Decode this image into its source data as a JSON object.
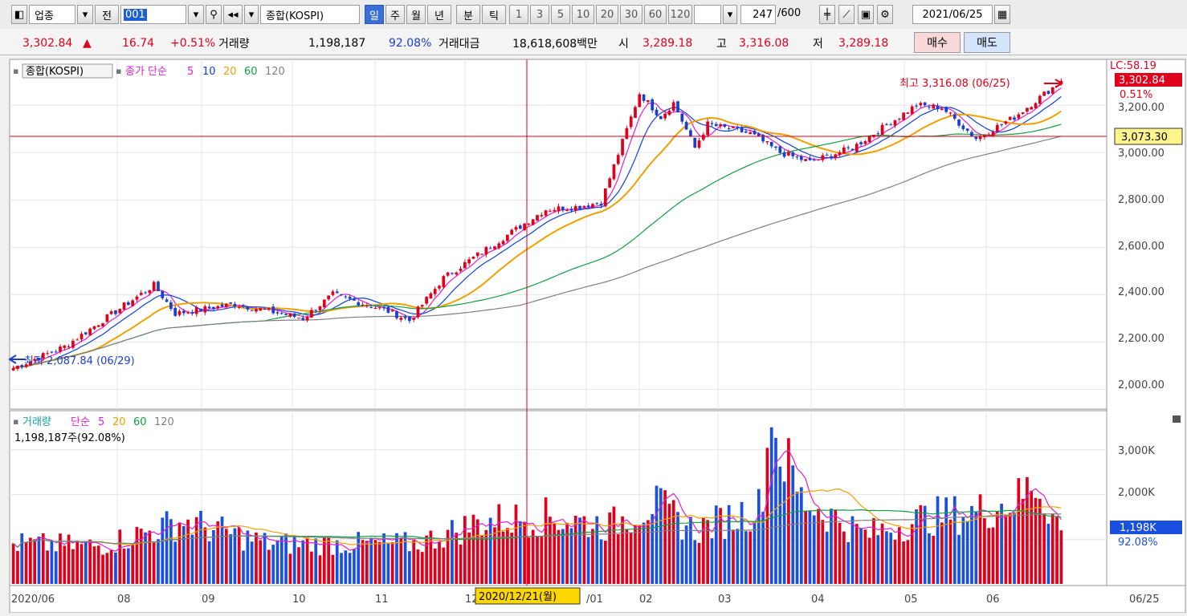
{
  "toolbar": {
    "market_type": "업종",
    "prev_label": "전",
    "code": "001",
    "index_name": "종합(KOSPI)",
    "periods": [
      "일",
      "주",
      "월",
      "년",
      "분",
      "틱"
    ],
    "active_period": "일",
    "intervals": [
      "1",
      "3",
      "5",
      "10",
      "20",
      "30",
      "60",
      "120"
    ],
    "count_value": "247",
    "count_total": "/600",
    "date": "2021/06/25"
  },
  "quote": {
    "price": "3,302.84",
    "up_arrow": "▲",
    "change": "16.74",
    "change_pct": "+0.51%",
    "volume_label": "거래량",
    "volume": "1,198,187",
    "volume_ratio": "92.08%",
    "amount_label": "거래대금",
    "amount": "18,618,608백만",
    "open_label": "시",
    "open": "3,289.18",
    "high_label": "고",
    "high": "3,316.08",
    "low_label": "저",
    "low": "3,289.18",
    "buy_label": "매수",
    "sell_label": "매도"
  },
  "price_panel": {
    "name_tag": "종합(KOSPI)",
    "legend_prefix": "종가 단순",
    "ma_labels": [
      "5",
      "10",
      "20",
      "60",
      "120"
    ],
    "ma_colors": [
      "#e020d0",
      "#1040e0",
      "#f0a000",
      "#10a040",
      "#808080"
    ],
    "high_note": "최고 3,316.08 (06/25)",
    "low_note": "최저 2,087.84 (06/29)",
    "lc_label": "LC:58.19",
    "last_price": "3,302.84",
    "last_pct": "0.51%",
    "crosshair_value": "3,073.30",
    "y_ticks": [
      "3,200.00",
      "3,000.00",
      "2,800.00",
      "2,600.00",
      "2,400.00",
      "2,200.00",
      "2,000.00"
    ]
  },
  "volume_panel": {
    "title": "거래량",
    "legend_prefix": "단순",
    "ma_labels": [
      "5",
      "20",
      "60",
      "120"
    ],
    "ma_colors": [
      "#e020d0",
      "#f0a000",
      "#10a040",
      "#808080"
    ],
    "readout": "1,198,187주(92.08%)",
    "last_volume": "1,198K",
    "last_pct": "92.08%",
    "y_ticks": [
      "3,000K",
      "2,000K"
    ]
  },
  "x_axis": {
    "labels": [
      "2020/06",
      "08",
      "09",
      "10",
      "11",
      "12",
      "/01",
      "02",
      "03",
      "04",
      "05",
      "06"
    ],
    "crosshair_date": "2020/12/21(월)",
    "right_label": "06/25"
  },
  "chart_data": {
    "type": "candlestick",
    "title": "종합(KOSPI)",
    "price_ylim": [
      1930,
      3380
    ],
    "price_key_points": [
      {
        "x": "2020/06/29",
        "y": 2087.84,
        "label": "최저"
      },
      {
        "x": "2020/08/14",
        "y": 2440
      },
      {
        "x": "2020/09/25",
        "y": 2280
      },
      {
        "x": "2020/10/30",
        "y": 2270
      },
      {
        "x": "2020/11/30",
        "y": 2600
      },
      {
        "x": "2020/12/21",
        "y": 2760
      },
      {
        "x": "2021/01/11",
        "y": 3260
      },
      {
        "x": "2021/02/01",
        "y": 2980
      },
      {
        "x": "2021/03/08",
        "y": 2980
      },
      {
        "x": "2021/04/28",
        "y": 3220
      },
      {
        "x": "2021/05/12",
        "y": 3120
      },
      {
        "x": "2021/06/25",
        "y": 3316.08,
        "label": "최고"
      }
    ],
    "ma_periods": [
      5,
      10,
      20,
      60,
      120
    ],
    "volume_ylim": [
      0,
      3800
    ],
    "volume_unit": "K",
    "volume_key_points": [
      {
        "x": "2020/06",
        "y": 900
      },
      {
        "x": "2020/08",
        "y": 1400
      },
      {
        "x": "2020/12",
        "y": 1600
      },
      {
        "x": "2021/01",
        "y": 1800
      },
      {
        "x": "2021/02",
        "y": 3500
      },
      {
        "x": "2021/06",
        "y": 2300
      },
      {
        "x": "2021/06/25",
        "y": 1198
      }
    ]
  }
}
